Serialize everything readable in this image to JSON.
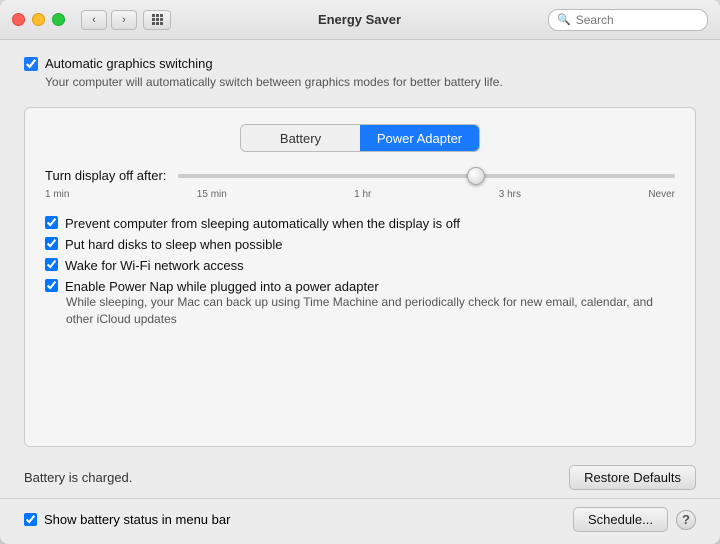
{
  "window": {
    "title": "Energy Saver"
  },
  "search": {
    "placeholder": "Search"
  },
  "top": {
    "checkbox_label": "Automatic graphics switching",
    "checkbox_checked": true,
    "checkbox_sublabel": "Your computer will automatically switch between graphics modes for better battery life."
  },
  "tabs": {
    "battery": "Battery",
    "power_adapter": "Power Adapter"
  },
  "slider": {
    "label": "Turn display off after:",
    "ticks": [
      "1 min",
      "15 min",
      "1 hr",
      "3 hrs",
      "Never"
    ]
  },
  "options": [
    {
      "label": "Prevent computer from sleeping automatically when the display is off",
      "checked": true,
      "sub": ""
    },
    {
      "label": "Put hard disks to sleep when possible",
      "checked": true,
      "sub": ""
    },
    {
      "label": "Wake for Wi-Fi network access",
      "checked": true,
      "sub": ""
    },
    {
      "label": "Enable Power Nap while plugged into a power adapter",
      "checked": true,
      "sub": "While sleeping, your Mac can back up using Time Machine and periodically check for new email, calendar, and other iCloud updates"
    }
  ],
  "bottom": {
    "status": "Battery is charged.",
    "restore_btn": "Restore Defaults"
  },
  "footer": {
    "show_battery_label": "Show battery status in menu bar",
    "show_battery_checked": true,
    "schedule_btn": "Schedule...",
    "help_btn": "?"
  }
}
